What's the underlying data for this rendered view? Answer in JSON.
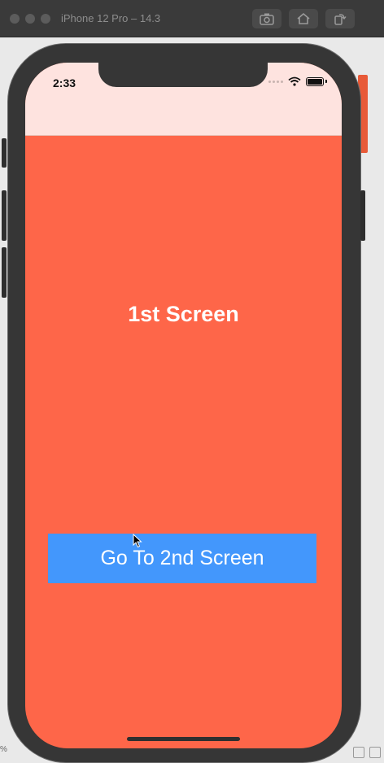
{
  "window": {
    "title": "iPhone 12 Pro – 14.3",
    "toolbar": [
      "screenshot-icon",
      "home-icon",
      "rotate-icon"
    ]
  },
  "status_bar": {
    "time": "2:33"
  },
  "screen": {
    "heading": "1st Screen",
    "button_label": "Go To 2nd Screen"
  },
  "colors": {
    "screen_background": "#fe6649",
    "nav_background": "#fee3df",
    "button_background": "#4397fc",
    "text": "#ffffff"
  },
  "footer": {
    "left_text": "%"
  }
}
